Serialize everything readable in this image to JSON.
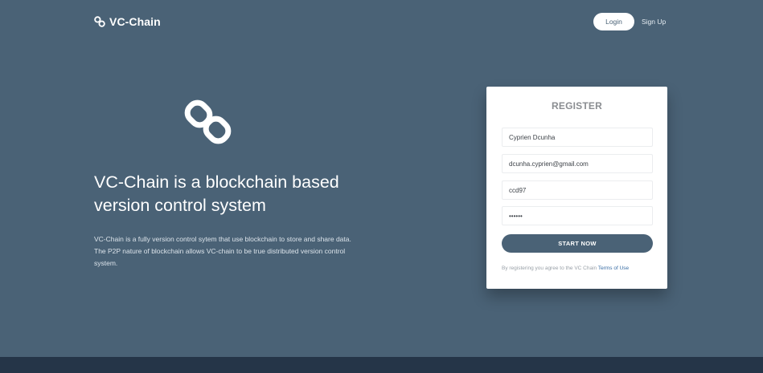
{
  "header": {
    "brand_name": "VC-Chain",
    "brand_icon": "link-icon",
    "login_label": "Login",
    "signup_label": "Sign Up"
  },
  "hero": {
    "icon": "link-icon",
    "title": "VC-Chain is a blockchain based version control system",
    "description": "VC-Chain is a fully version control sytem that use blockchain to store and share data. The P2P nature of blockchain allows VC-chain to be true distributed version control system."
  },
  "register": {
    "title": "REGISTER",
    "fields": {
      "name": "Cyprien Dcunha",
      "email": "dcunha.cyprien@gmail.com",
      "username": "ccd97",
      "password": "123456"
    },
    "submit_label": "START NOW",
    "terms_text": "By registering you agree to the VC Chain ",
    "terms_link": "Terms of Use"
  },
  "colors": {
    "background": "#4a6276",
    "footer": "#253548",
    "card": "#ffffff",
    "button": "#4a6276",
    "link": "#3a6ea5"
  }
}
